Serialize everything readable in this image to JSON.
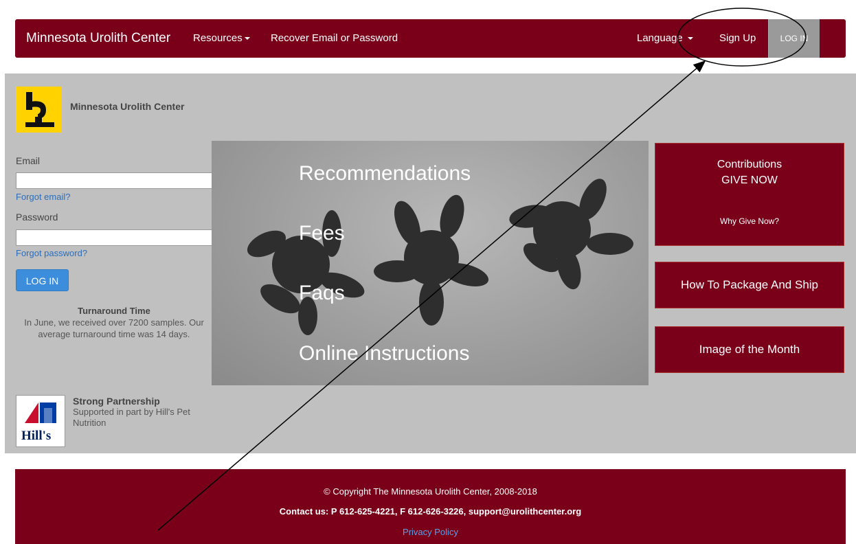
{
  "navbar": {
    "brand": "Minnesota Urolith Center",
    "resources": "Resources",
    "recover": "Recover Email or Password",
    "language": "Language",
    "signup": "Sign Up",
    "login": "LOG IN"
  },
  "sidebar": {
    "org_name": "Minnesota Urolith Center",
    "email_label": "Email",
    "forgot_email": "Forgot email?",
    "password_label": "Password",
    "forgot_password": "Forgot password?",
    "login_button": "LOG IN",
    "turnaround_title": "Turnaround Time",
    "turnaround_text": "In June, we received over 7200 samples. Our average turnaround time was 14 days.",
    "partner_title": "Strong Partnership",
    "partner_text": "Supported in part by Hill's Pet Nutrition",
    "partner_logo_text": "Hill's"
  },
  "hero": {
    "links": [
      "Recommendations",
      "Fees",
      "Faqs",
      "Online Instructions"
    ]
  },
  "cards": {
    "contrib_title": "Contributions",
    "contrib_give": "GIVE NOW",
    "contrib_why": "Why Give Now?",
    "ship": "How To Package And Ship",
    "image_month": "Image of the Month"
  },
  "footer": {
    "copyright": "© Copyright The Minnesota Urolith Center, 2008-2018",
    "contact": "Contact us: P 612-625-4221, F 612-626-3226, support@urolithcenter.org",
    "privacy": "Privacy Policy"
  },
  "colors": {
    "brand_maroon": "#7a0019",
    "panel_grey": "#c0c0c0",
    "link_blue": "#2a6ebb",
    "button_blue": "#3c8ddc"
  }
}
